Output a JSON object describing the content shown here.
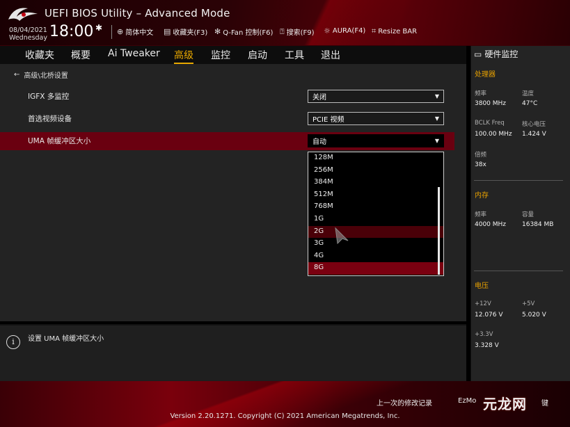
{
  "header": {
    "title": "UEFI BIOS Utility – Advanced Mode",
    "date": "08/04/2021",
    "weekday": "Wednesday",
    "time": "18:00",
    "buttons": [
      {
        "icon": "globe-icon",
        "label": "简体中文"
      },
      {
        "icon": "favorites-icon",
        "label": "收藏夹(F3)"
      },
      {
        "icon": "fan-icon",
        "label": "Q-Fan 控制(F6)"
      },
      {
        "icon": "help-icon",
        "label": "搜索(F9)"
      },
      {
        "icon": "aura-icon",
        "label": "AURA(F4)"
      },
      {
        "icon": "resize-bar-icon",
        "label": "Resize BAR"
      }
    ]
  },
  "nav": {
    "tabs": [
      "收藏夹",
      "概要",
      "Ai Tweaker",
      "高级",
      "监控",
      "启动",
      "工具",
      "退出"
    ],
    "active": "高级"
  },
  "main": {
    "breadcrumb": "高级\\北桥设置",
    "rows": [
      {
        "label": "IGFX 多监控",
        "value": "关闭"
      },
      {
        "label": "首选视频设备",
        "value": "PCIE 视频"
      },
      {
        "label": "UMA 帧缓冲区大小",
        "value": "自动"
      }
    ],
    "options": [
      "128M",
      "256M",
      "384M",
      "512M",
      "768M",
      "1G",
      "2G",
      "3G",
      "4G",
      "8G"
    ],
    "hover_option": "2G",
    "selected_option": "8G"
  },
  "help": {
    "text": "设置 UMA 帧缓冲区大小"
  },
  "hw_monitor": {
    "title": "硬件监控",
    "cpu": {
      "title": "处理器",
      "freq_label": "频率",
      "freq": "3800 MHz",
      "temp_label": "温度",
      "temp": "47°C",
      "bclk_label": "BCLK Freq",
      "bclk": "100.00 MHz",
      "vcore_label": "核心电压",
      "vcore": "1.424 V",
      "ratio_label": "倍频",
      "ratio": "38x"
    },
    "memory": {
      "title": "内存",
      "freq_label": "频率",
      "freq": "4000 MHz",
      "cap_label": "容量",
      "cap": "16384 MB"
    },
    "voltage": {
      "title": "电压",
      "v12_label": "+12V",
      "v12": "12.076 V",
      "v5_label": "+5V",
      "v5": "5.020 V",
      "v33_label": "+3.3V",
      "v33": "3.328 V"
    }
  },
  "footer": {
    "last_modified": "上一次的修改记录",
    "ezmode": "EzMo",
    "hotkeys": "键",
    "version": "Version 2.20.1271. Copyright (C) 2021 American Megatrends, Inc.",
    "watermark": "元龙网"
  },
  "colors": {
    "accent": "#e8a800",
    "highlight_row": "#6a0010",
    "selected_option": "#7a0010"
  }
}
